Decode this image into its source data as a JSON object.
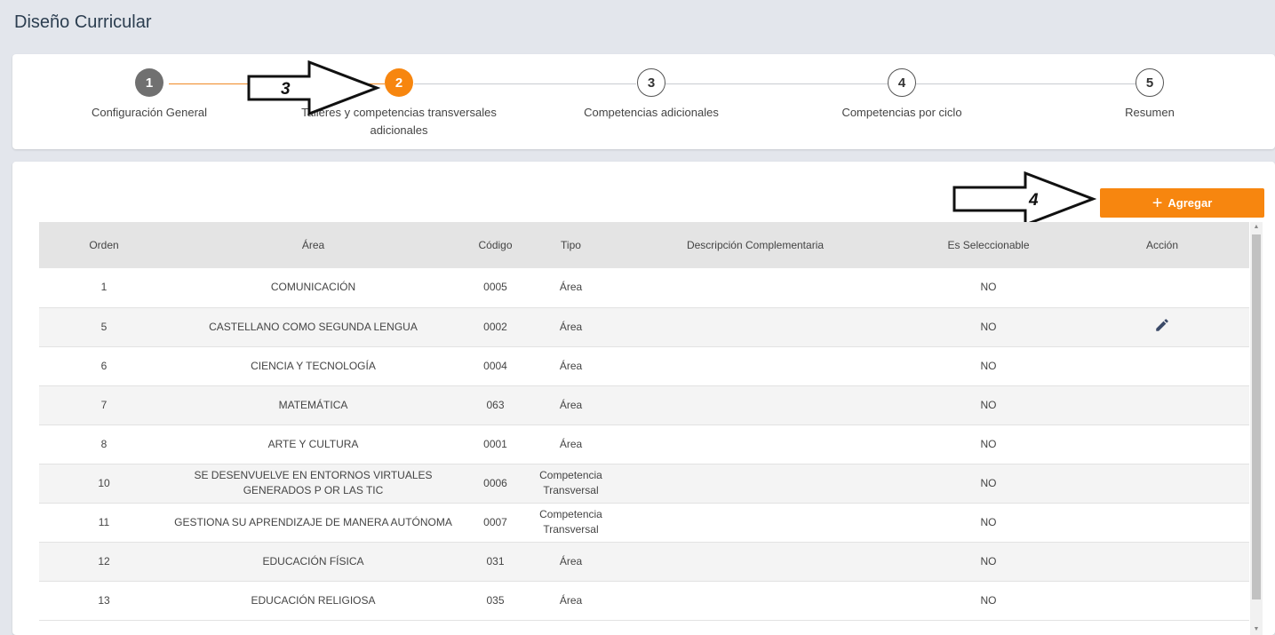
{
  "page": {
    "title": "Diseño Curricular"
  },
  "stepper": {
    "steps": [
      {
        "number": "1",
        "label": "Configuración General",
        "state": "completed"
      },
      {
        "number": "2",
        "label": "Talleres y competencias transversales adicionales",
        "state": "active"
      },
      {
        "number": "3",
        "label": "Competencias adicionales",
        "state": "pending"
      },
      {
        "number": "4",
        "label": "Competencias por ciclo",
        "state": "pending"
      },
      {
        "number": "5",
        "label": "Resumen",
        "state": "pending"
      }
    ]
  },
  "annotations": {
    "arrow_3": "3",
    "arrow_4": "4"
  },
  "toolbar": {
    "add_label": "Agregar",
    "add_icon": "plus-icon"
  },
  "table": {
    "headers": [
      "Orden",
      "Área",
      "Código",
      "Tipo",
      "Descripción Complementaria",
      "Es Seleccionable",
      "Acción"
    ],
    "rows": [
      {
        "orden": "1",
        "area": "COMUNICACIÓN",
        "codigo": "0005",
        "tipo": "Área",
        "descripcion": "",
        "seleccionable": "NO",
        "accion": ""
      },
      {
        "orden": "5",
        "area": "CASTELLANO COMO SEGUNDA LENGUA",
        "codigo": "0002",
        "tipo": "Área",
        "descripcion": "",
        "seleccionable": "NO",
        "accion": "edit-icon"
      },
      {
        "orden": "6",
        "area": "CIENCIA Y TECNOLOGÍA",
        "codigo": "0004",
        "tipo": "Área",
        "descripcion": "",
        "seleccionable": "NO",
        "accion": ""
      },
      {
        "orden": "7",
        "area": "MATEMÁTICA",
        "codigo": "063",
        "tipo": "Área",
        "descripcion": "",
        "seleccionable": "NO",
        "accion": ""
      },
      {
        "orden": "8",
        "area": "ARTE Y CULTURA",
        "codigo": "0001",
        "tipo": "Área",
        "descripcion": "",
        "seleccionable": "NO",
        "accion": ""
      },
      {
        "orden": "10",
        "area": "SE DESENVUELVE EN ENTORNOS VIRTUALES GENERADOS P OR LAS TIC",
        "codigo": "0006",
        "tipo": "Competencia Transversal",
        "descripcion": "",
        "seleccionable": "NO",
        "accion": ""
      },
      {
        "orden": "11",
        "area": "GESTIONA SU APRENDIZAJE DE MANERA AUTÓNOMA",
        "codigo": "0007",
        "tipo": "Competencia Transversal",
        "descripcion": "",
        "seleccionable": "NO",
        "accion": ""
      },
      {
        "orden": "12",
        "area": "EDUCACIÓN FÍSICA",
        "codigo": "031",
        "tipo": "Área",
        "descripcion": "",
        "seleccionable": "NO",
        "accion": ""
      },
      {
        "orden": "13",
        "area": "EDUCACIÓN RELIGIOSA",
        "codigo": "035",
        "tipo": "Área",
        "descripcion": "",
        "seleccionable": "NO",
        "accion": ""
      }
    ]
  },
  "colors": {
    "accent": "#f7860f",
    "completed": "#707070",
    "header_bg": "#e4e4e4",
    "edit_icon": "#3b4a68"
  }
}
